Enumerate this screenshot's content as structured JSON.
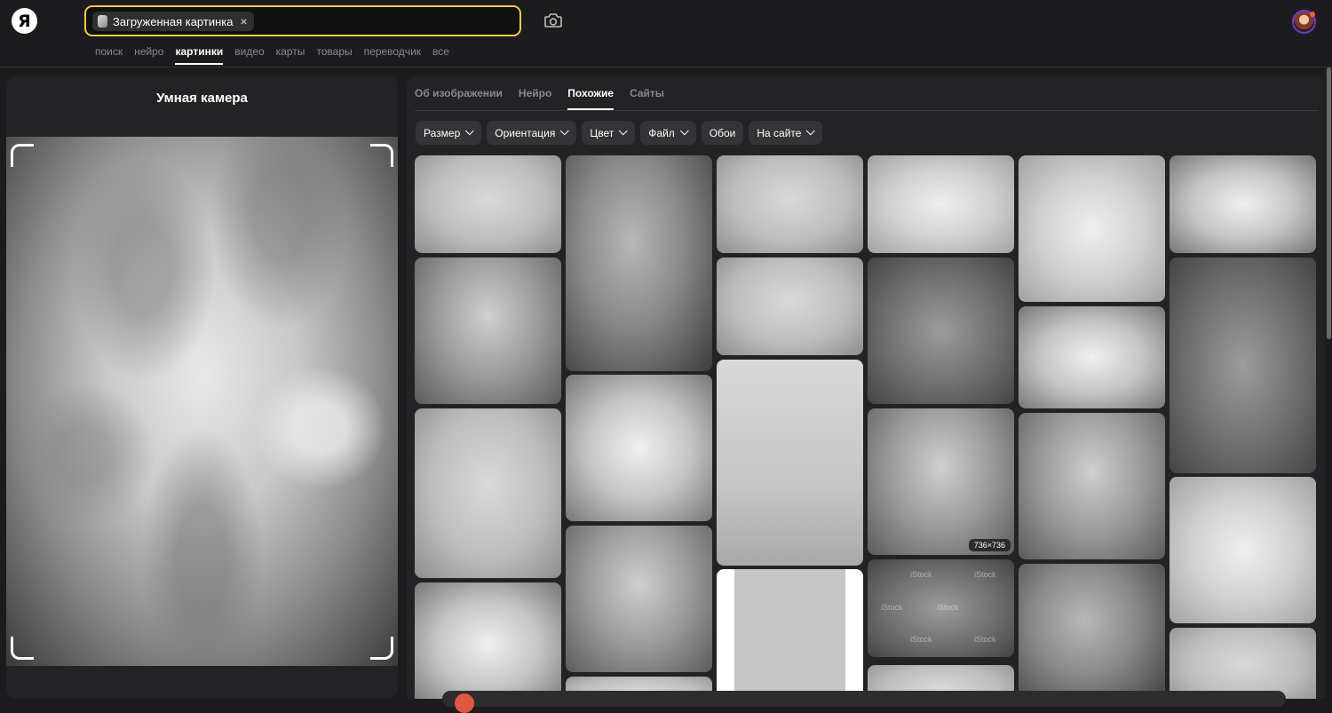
{
  "header": {
    "logo": "Я",
    "search_chip_label": "Загруженная картинка",
    "search_chip_close": "×",
    "nav": [
      "поиск",
      "нейро",
      "картинки",
      "видео",
      "карты",
      "товары",
      "переводчик",
      "все"
    ],
    "nav_active": "картинки"
  },
  "left_panel": {
    "title": "Умная камера"
  },
  "right_panel": {
    "tabs": [
      "Об изображении",
      "Нейро",
      "Похожие",
      "Сайты"
    ],
    "tab_active": "Похожие",
    "filters": [
      {
        "label": "Размер",
        "dropdown": true
      },
      {
        "label": "Ориентация",
        "dropdown": true
      },
      {
        "label": "Цвет",
        "dropdown": true
      },
      {
        "label": "Файл",
        "dropdown": true
      },
      {
        "label": "Обои",
        "dropdown": false
      },
      {
        "label": "На сайте",
        "dropdown": true
      }
    ],
    "image_size_badge": "736×736",
    "watermark": "iStock"
  },
  "colors": {
    "search_border": "#f2c94c",
    "background": "#1c1c1e",
    "panel": "#232325",
    "filter_button": "#343437",
    "avatar_ring": "#6a3bd0"
  },
  "icons": {
    "camera": "camera-search-icon",
    "close": "close-icon",
    "chevron": "chevron-down-icon"
  }
}
